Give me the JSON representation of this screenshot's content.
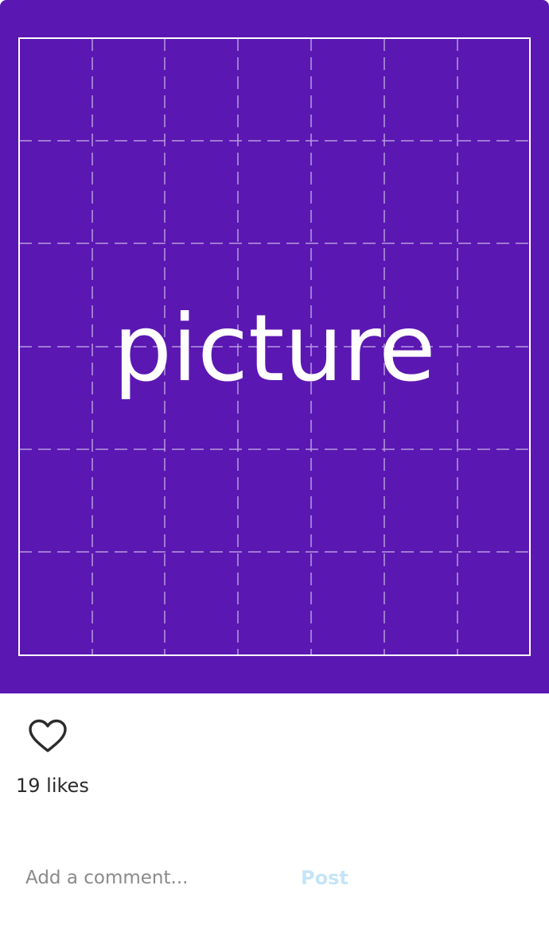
{
  "post": {
    "image_label": "picture",
    "likes_text": "19 likes",
    "comment": {
      "placeholder": "Add a comment...",
      "value": "",
      "post_label": "Post"
    }
  },
  "colors": {
    "image_background": "#5b17b2",
    "grid_line": "#b79be0",
    "frame": "#ffffff",
    "post_disabled": "#c6e4f7",
    "icon": "#2b2b2b"
  },
  "icons": {
    "like": "heart-outline-icon"
  }
}
